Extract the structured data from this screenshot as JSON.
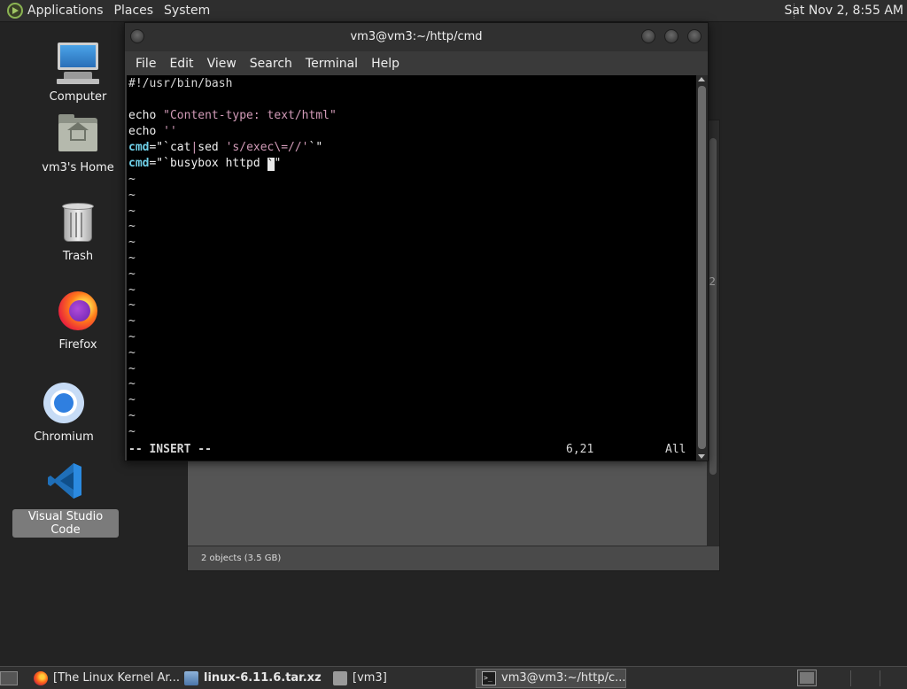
{
  "top_panel": {
    "menus": [
      "Applications",
      "Places",
      "System"
    ],
    "clock": "Sat Nov  2,  8:55 AM"
  },
  "desktop_icons": [
    {
      "label": "Computer",
      "icon": "computer-icon"
    },
    {
      "label": "vm3's Home",
      "icon": "home-folder-icon"
    },
    {
      "label": "Trash",
      "icon": "trash-icon"
    },
    {
      "label": "Firefox",
      "icon": "firefox-icon"
    },
    {
      "label": "Chromium",
      "icon": "chromium-icon"
    },
    {
      "label": "Visual Studio Code",
      "icon": "vscode-icon",
      "selected": true
    }
  ],
  "background_window": {
    "status": "2 objects (3.5 GB)",
    "peek_char": "2"
  },
  "terminal": {
    "title": "vm3@vm3:~/http/cmd",
    "menus": [
      "File",
      "Edit",
      "View",
      "Search",
      "Terminal",
      "Help"
    ],
    "lines": {
      "l1": "#!/usr/bin/bash",
      "l3_cmd": "echo",
      "l3_str": "\"Content-type: text/html\"",
      "l4_cmd": "echo",
      "l4_str": "''",
      "l5_var": "cmd",
      "l5_eq": "=\"`cat",
      "l5_pipe": "|",
      "l5_sed": "sed ",
      "l5_str": "'s/exec\\=//'",
      "l5_end": "`\"",
      "l6_var": "cmd",
      "l6_eq": "=\"`busybox httpd ",
      "l6_cursor": "`",
      "l6_end": "\""
    },
    "tilde": "~",
    "mode": "-- INSERT --",
    "position": "6,21",
    "scroll": "All"
  },
  "taskbar": {
    "tasks": [
      {
        "label": "[The Linux Kernel Ar...",
        "icon": "firefox-icon"
      },
      {
        "label": "linux-6.11.6.tar.xz",
        "icon": "archive-icon"
      },
      {
        "label": "[vm3]",
        "icon": "folder-icon"
      },
      {
        "label": "vm3@vm3:~/http/c...",
        "icon": "terminal-icon",
        "active": true
      }
    ]
  }
}
